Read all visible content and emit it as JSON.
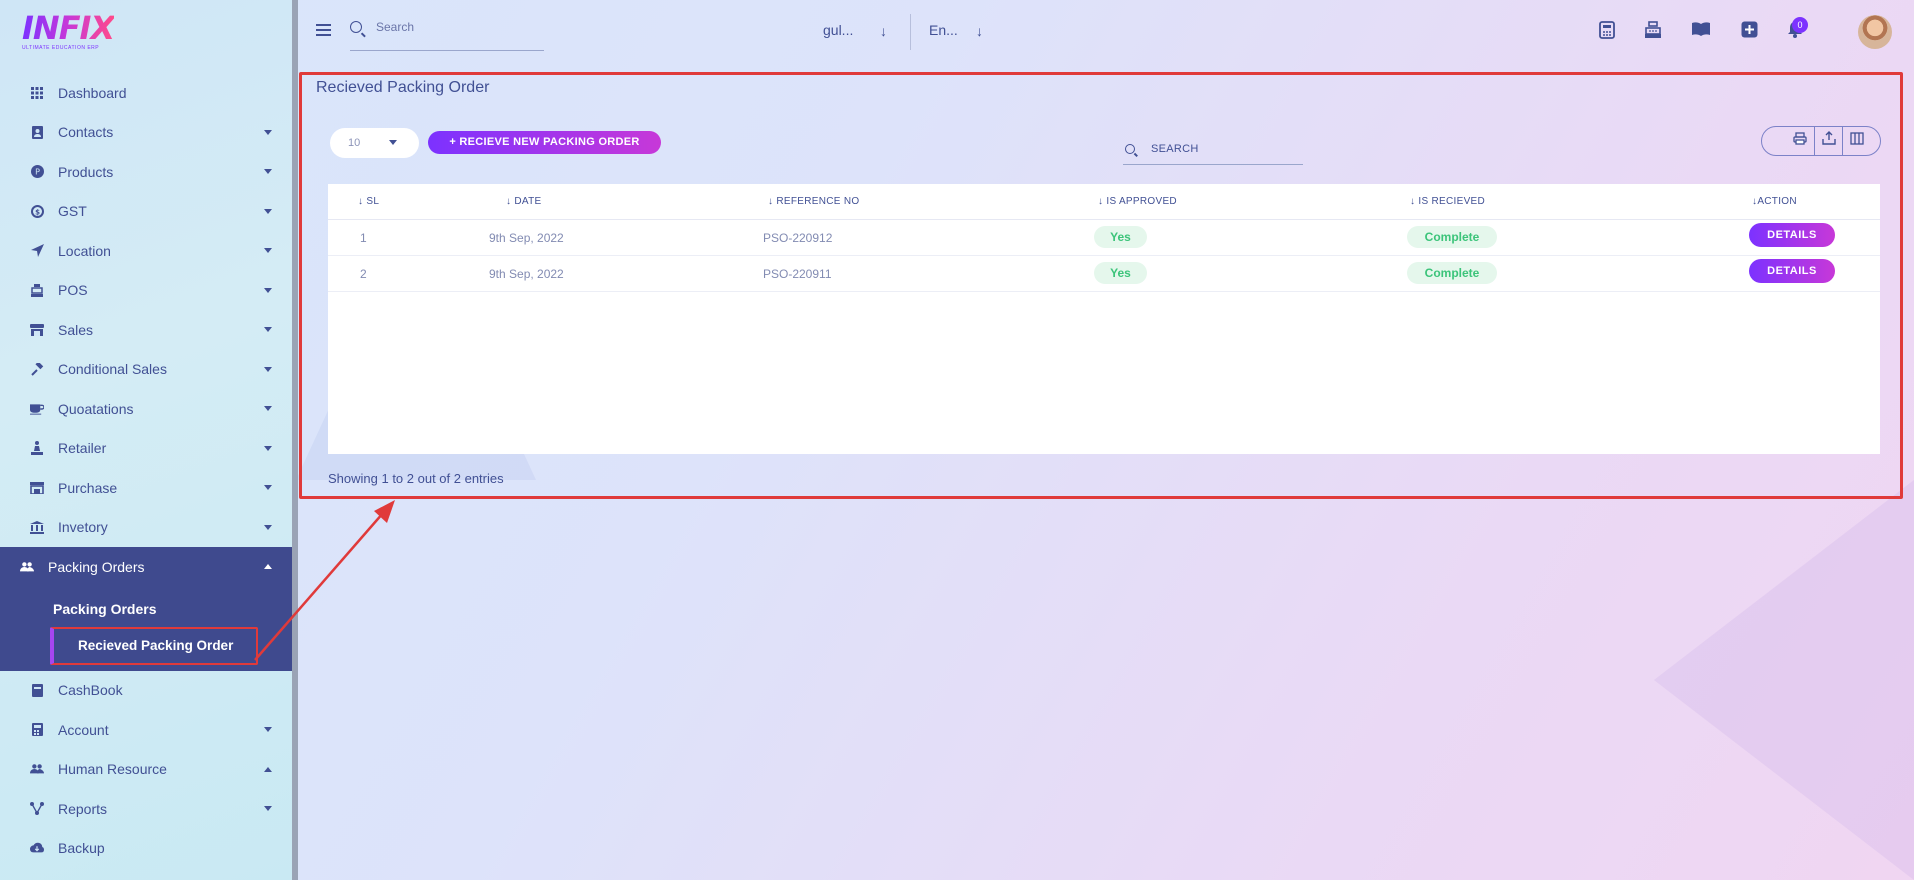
{
  "app": {
    "logo_text": "INFIX",
    "logo_sub": "ULTIMATE EDUCATION ERP"
  },
  "sidebar": {
    "items": [
      {
        "label": "Dashboard",
        "icon": "grid-icon",
        "caret": false
      },
      {
        "label": "Contacts",
        "icon": "contacts-icon",
        "caret": true
      },
      {
        "label": "Products",
        "icon": "products-icon",
        "caret": true
      },
      {
        "label": "GST",
        "icon": "gst-icon",
        "caret": true
      },
      {
        "label": "Location",
        "icon": "location-arrow-icon",
        "caret": true
      },
      {
        "label": "POS",
        "icon": "pos-icon",
        "caret": true
      },
      {
        "label": "Sales",
        "icon": "store-icon",
        "caret": true
      },
      {
        "label": "Conditional Sales",
        "icon": "gavel-icon",
        "caret": true
      },
      {
        "label": "Quoatations",
        "icon": "coffee-icon",
        "caret": true
      },
      {
        "label": "Retailer",
        "icon": "retailer-icon",
        "caret": true
      },
      {
        "label": "Purchase",
        "icon": "purchase-icon",
        "caret": true
      },
      {
        "label": "Invetory",
        "icon": "bank-icon",
        "caret": true
      }
    ],
    "active_group": {
      "label": "Packing Orders",
      "icon": "users-icon",
      "sub_items": [
        "Packing Orders",
        "Recieved Packing Order"
      ]
    },
    "items_after": [
      {
        "label": "CashBook",
        "icon": "book-icon",
        "caret": false
      },
      {
        "label": "Account",
        "icon": "calculator-icon",
        "caret": true
      },
      {
        "label": "Human Resource",
        "icon": "users-icon",
        "caret": true
      },
      {
        "label": "Reports",
        "icon": "reports-icon",
        "caret": true
      },
      {
        "label": "Backup",
        "icon": "cloud-download-icon",
        "caret": false
      }
    ]
  },
  "topbar": {
    "search_placeholder": "Search",
    "branch_select": "gul...",
    "language_select": "En...",
    "notification_count": "0"
  },
  "main": {
    "title": "Recieved Packing Order",
    "page_length": "10",
    "new_button": "+ RECIEVE NEW PACKING ORDER",
    "search_placeholder": "SEARCH",
    "columns": [
      "SL",
      "DATE",
      "REFERENCE NO",
      "IS APPROVED",
      "IS RECIEVED",
      "ACTION"
    ],
    "rows": [
      {
        "sl": "1",
        "date": "9th Sep, 2022",
        "ref": "PSO-220912",
        "approved": "Yes",
        "received": "Complete",
        "action": "DETAILS"
      },
      {
        "sl": "2",
        "date": "9th Sep, 2022",
        "ref": "PSO-220911",
        "approved": "Yes",
        "received": "Complete",
        "action": "DETAILS"
      }
    ],
    "showing": "Showing 1 to 2 out of 2 entries"
  },
  "colors": {
    "primary": "#7c32ff",
    "accent": "#c738d8",
    "text": "#415094",
    "active_bg": "#3f4a8e",
    "success": "#3cc47a",
    "highlight": "#e03a3a"
  }
}
